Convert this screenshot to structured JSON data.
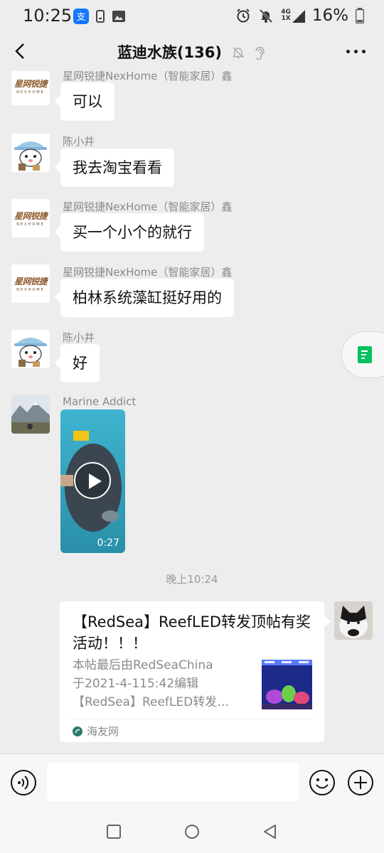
{
  "status_bar": {
    "time": "10:25",
    "network_top": "4G",
    "network_bottom": "1X",
    "battery": "16%"
  },
  "header": {
    "title": "蓝迪水族(136)",
    "icons": [
      "back-icon",
      "mute-icon",
      "ear-icon",
      "more-icon"
    ]
  },
  "messages": [
    {
      "sender": "星网锐捷NexHome（智能家居）鑫",
      "text": "可以",
      "avatar": "nexhome-logo"
    },
    {
      "sender": "陈小井",
      "text": "我去淘宝看看",
      "avatar": "cartoon-avatar"
    },
    {
      "sender": "星网锐捷NexHome（智能家居）鑫",
      "text": "买一个小个的就行",
      "avatar": "nexhome-logo"
    },
    {
      "sender": "星网锐捷NexHome（智能家居）鑫",
      "text": "柏林系统藻缸挺好用的",
      "avatar": "nexhome-logo"
    },
    {
      "sender": "陈小井",
      "text": "好",
      "avatar": "cartoon-avatar"
    },
    {
      "sender": "Marine Addict",
      "video_duration": "0:27",
      "avatar": "landscape-photo"
    }
  ],
  "logo": {
    "cn": "星网锐捷",
    "en": "NEXHOME"
  },
  "timestamp": "晚上10:24",
  "link_card": {
    "title": "【RedSea】ReefLED转发顶帖有奖活动！！！",
    "desc_lines": [
      "本帖最后由RedSeaChina",
      "于2021-4-115:42编辑",
      "【RedSea】ReefLED转发…"
    ],
    "source": "海友网"
  },
  "colors": {
    "background": "#ededed",
    "bubble": "#ffffff",
    "accent_green": "#07c160"
  }
}
